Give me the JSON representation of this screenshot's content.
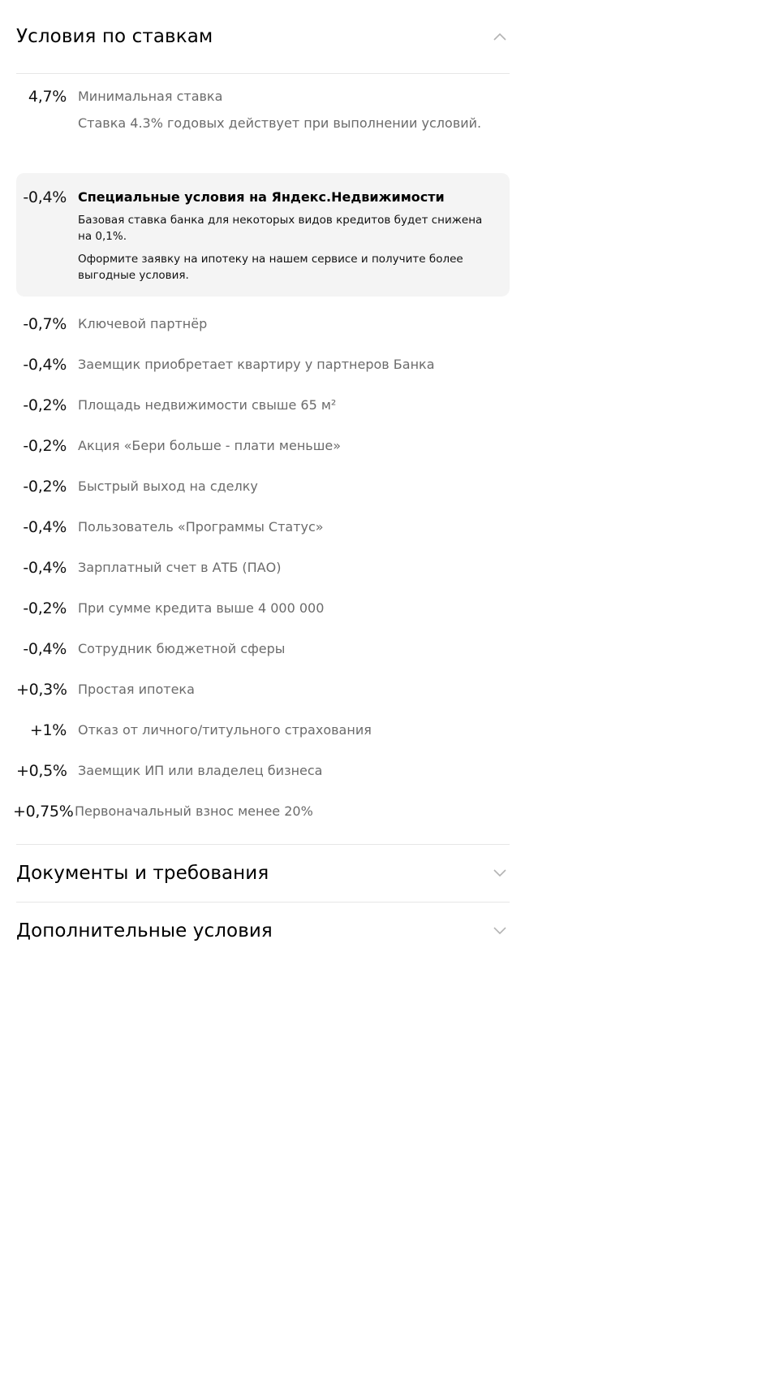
{
  "sections": {
    "rates": {
      "title": "Условия по ставкам",
      "expanded": true
    },
    "documents": {
      "title": "Документы и требования",
      "expanded": false
    },
    "additional": {
      "title": "Дополнительные условия",
      "expanded": false
    }
  },
  "minimum": {
    "value": "4,7%",
    "label": "Минимальная ставка",
    "note": "Ставка 4.3% годовых действует при выполнении условий."
  },
  "special": {
    "value": "-0,4%",
    "title": "Специальные условия на Яндекс.Недвижимости",
    "line1": "Базовая ставка банка для некоторых видов кредитов будет снижена на 0,1%.",
    "line2": "Оформите заявку на ипотеку на нашем сервисе и получите более выгодные условия."
  },
  "discounts": [
    {
      "value": "-0,7%",
      "label": "Ключевой партнёр"
    },
    {
      "value": "-0,4%",
      "label": "Заемщик приобретает квартиру у партнеров Банка"
    },
    {
      "value": "-0,2%",
      "label": "Площадь недвижимости свыше 65 м²"
    },
    {
      "value": "-0,2%",
      "label": "Акция «Бери больше - плати меньше»"
    },
    {
      "value": "-0,2%",
      "label": "Быстрый выход на сделку"
    },
    {
      "value": "-0,4%",
      "label": "Пользователь «Программы Статус»"
    },
    {
      "value": "-0,4%",
      "label": "Зарплатный счет в АТБ (ПАО)"
    },
    {
      "value": "-0,2%",
      "label": "При сумме кредита выше 4 000 000"
    },
    {
      "value": "-0,4%",
      "label": "Сотрудник бюджетной сферы"
    },
    {
      "value": "+0,3%",
      "label": "Простая ипотека"
    },
    {
      "value": "+1%",
      "label": "Отказ от личного/титульного страхования"
    },
    {
      "value": "+0,5%",
      "label": "Заемщик ИП или владелец бизнеса"
    },
    {
      "value": "+0,75%",
      "label": "Первоначальный взнос менее 20%"
    }
  ],
  "icons": {
    "expanded": "chevron-up-icon",
    "collapsed": "chevron-down-icon"
  },
  "colors": {
    "chevron": "#b3b3b3",
    "muted_text": "#6b6b6b",
    "card_background": "#f4f4f4",
    "divider": "#e6e6e6"
  }
}
